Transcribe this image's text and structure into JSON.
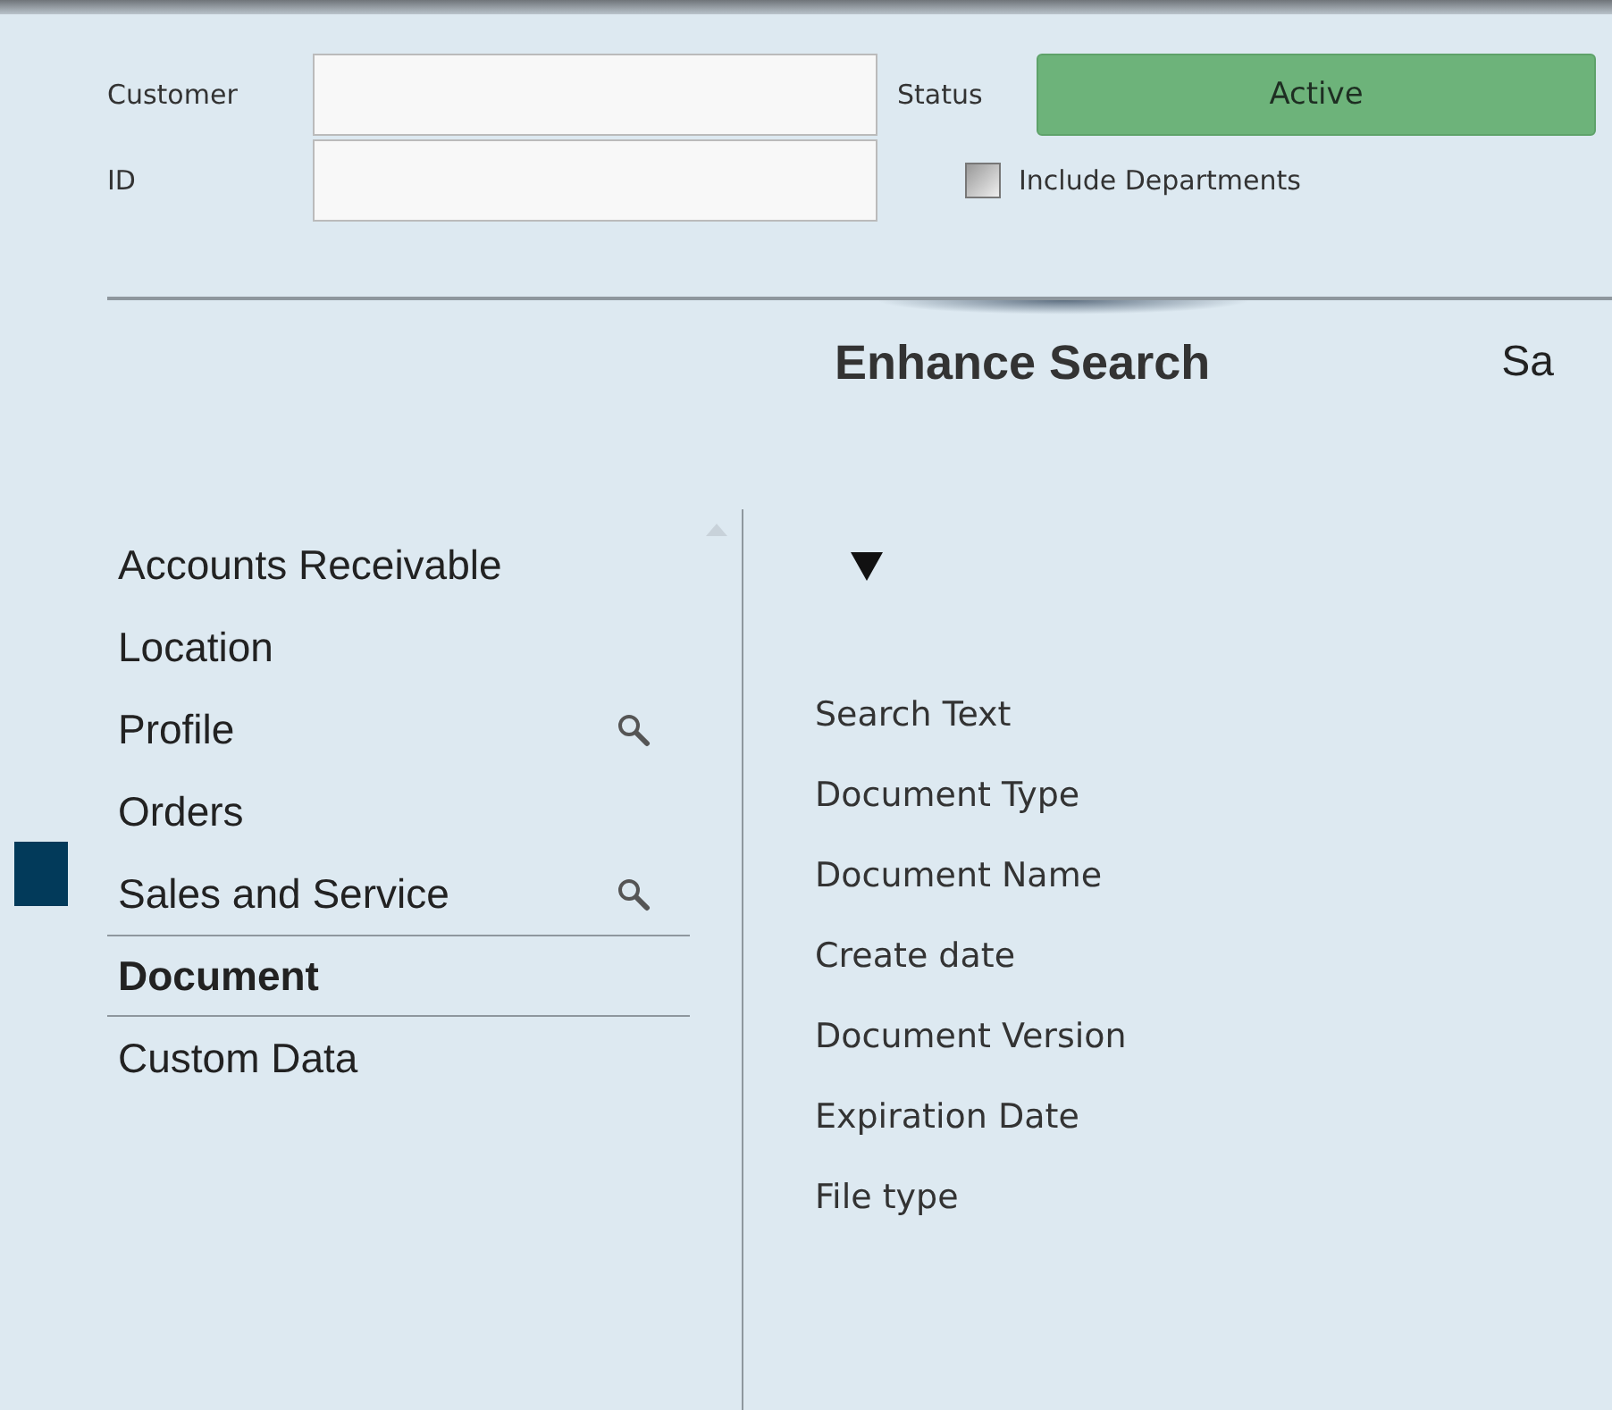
{
  "form": {
    "customer_label": "Customer",
    "id_label": "ID",
    "status_label": "Status",
    "status_value": "Active",
    "include_departments": {
      "label": "Include Departments",
      "checked": false
    }
  },
  "heading": "Enhance Search",
  "heading_cut": "Sa",
  "categories": [
    {
      "label": "Accounts Receivable",
      "search": false,
      "selected": false
    },
    {
      "label": "Location",
      "search": false,
      "selected": false
    },
    {
      "label": "Profile",
      "search": true,
      "selected": false
    },
    {
      "label": "Orders",
      "search": false,
      "selected": false
    },
    {
      "label": "Sales and Service",
      "search": true,
      "selected": false
    },
    {
      "label": "Document",
      "search": false,
      "selected": true
    },
    {
      "label": "Custom Data",
      "search": false,
      "selected": false
    }
  ],
  "fields": [
    "Search Text",
    "Document Type",
    "Document Name",
    "Create date",
    "Document Version",
    "Expiration Date",
    "File type"
  ]
}
